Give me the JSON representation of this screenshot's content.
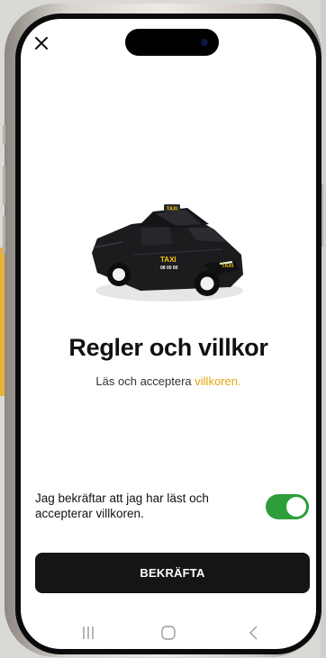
{
  "screen": {
    "title": "Regler och villkor",
    "subtitle_prefix": "Läs och acceptera ",
    "subtitle_link": "villkoren.",
    "consent_text": "Jag bekräftar att jag har läst och accepterar villkoren.",
    "consent_toggle_on": true,
    "confirm_label": "BEKRÄFTA"
  },
  "car_sign": {
    "roof_text": "TAXI",
    "door_text": "TAXI",
    "phone_text": "08 00 00"
  },
  "icons": {
    "close": "close-icon",
    "nav_recents": "recents-icon",
    "nav_home": "home-icon",
    "nav_back": "back-icon"
  },
  "colors": {
    "accent": "#e3a410",
    "toggle_on": "#2e9e3a",
    "button_bg": "#151518",
    "screen_bg": "#ffffff"
  }
}
